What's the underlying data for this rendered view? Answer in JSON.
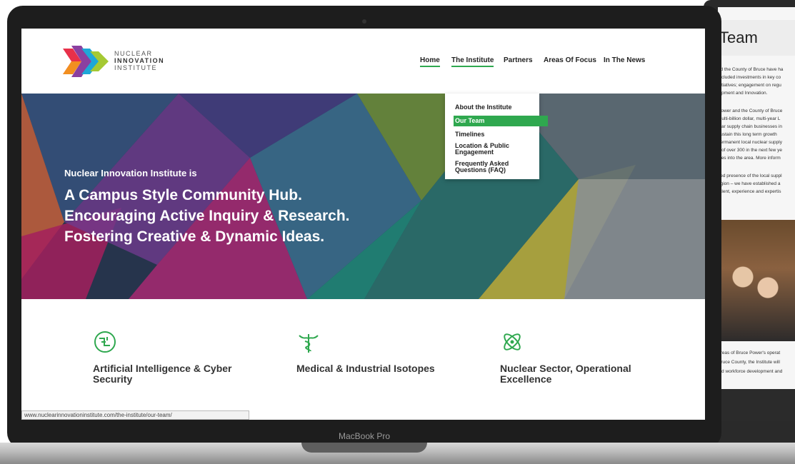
{
  "tablet": {
    "title": "Team",
    "lines": [
      "nd the County of Bruce have ha",
      "included investments in key co",
      "nitiatives; engagement on regu",
      "lopment and Innovation.",
      "Power and the County of Bruce",
      "multi-billion dollar, multi-year L",
      "lear supply chain businesses in",
      "sustain this long term growth",
      "permanent local nuclear supply",
      "s of over 300 in the next few ye",
      "ives into the area. More inform",
      "sed presence of the local suppl",
      "egion – we have established a",
      "talent, experience and expertis",
      "areas of Bruce Power's operat",
      "Bruce County, the Institute will",
      "led workforce development and"
    ]
  },
  "laptop": {
    "label": "MacBook Pro"
  },
  "site": {
    "logo": {
      "line1": "NUCLEAR",
      "line2": "INNOVATION",
      "line3": "INSTITUTE"
    },
    "nav": [
      "Home",
      "The Institute",
      "Partners",
      "Areas Of Focus",
      "In The News"
    ],
    "dropdown": [
      "About the Institute",
      "Our Team",
      "Timelines",
      "Location & Public Engagement",
      "Frequently Asked Questions (FAQ)"
    ],
    "hero": {
      "kicker": "Nuclear Innovation Institute is",
      "lines": [
        "A Campus Style Community Hub.",
        "Encouraging Active Inquiry & Research.",
        "Fostering Creative & Dynamic Ideas."
      ]
    },
    "features": [
      {
        "title": "Artificial Intelligence & Cyber Security",
        "icon": "brain-circuit-icon"
      },
      {
        "title": "Medical & Industrial Isotopes",
        "icon": "caduceus-icon"
      },
      {
        "title": "Nuclear Sector, Operational Excellence",
        "icon": "atom-icon"
      }
    ],
    "status_url": "www.nuclearinnovationinstitute.com/the-institute/our-team/",
    "colors": {
      "accent": "#2fa84f"
    }
  }
}
